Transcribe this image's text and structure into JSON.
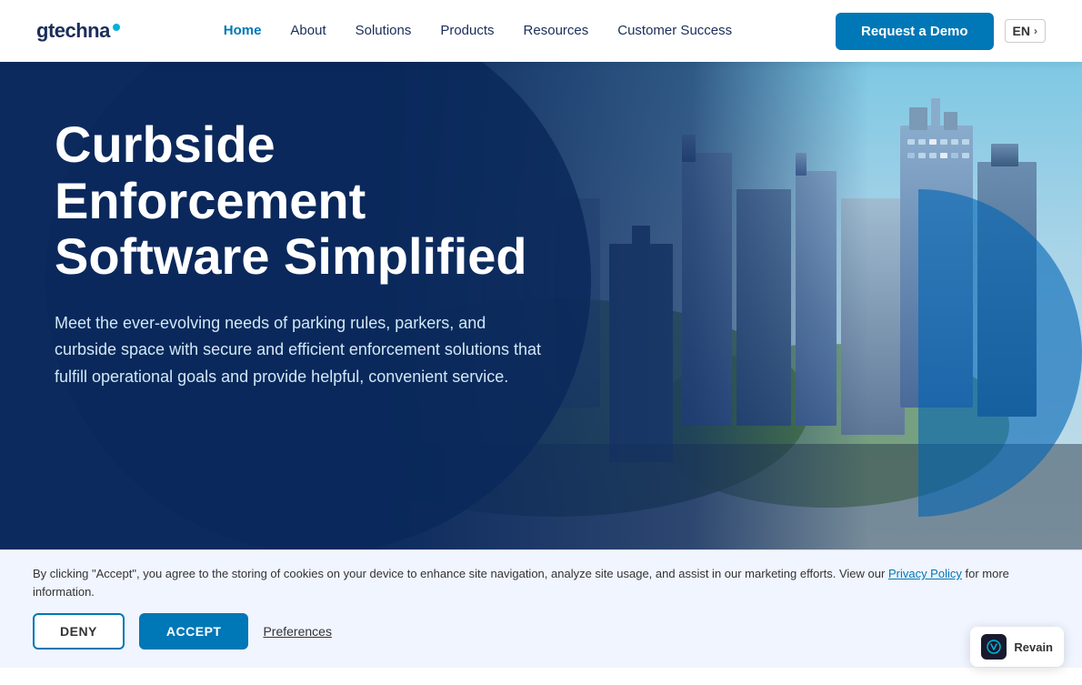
{
  "brand": {
    "logo_text": "gtechna",
    "logo_tm": "™"
  },
  "navbar": {
    "links": [
      {
        "label": "Home",
        "active": true
      },
      {
        "label": "About",
        "active": false
      },
      {
        "label": "Solutions",
        "active": false
      },
      {
        "label": "Products",
        "active": false
      },
      {
        "label": "Resources",
        "active": false
      },
      {
        "label": "Customer Success",
        "active": false
      }
    ],
    "cta_label": "Request a Demo",
    "lang_label": "EN"
  },
  "hero": {
    "title_line1": "Curbside",
    "title_line2": "Enforcement",
    "title_line3": "Software Simplified",
    "subtitle": "Meet the ever-evolving needs of parking rules, parkers, and curbside space with secure and efficient enforcement solutions that fulfill operational goals and provide helpful, convenient service."
  },
  "cookie": {
    "text": "By clicking \"Accept\", you agree to the storing of cookies on your device to enhance site navigation, analyze site usage, and assist in our marketing efforts. View our ",
    "privacy_link": "Privacy Policy",
    "text_after": " for more information.",
    "deny_label": "DENY",
    "accept_label": "ACCEPT",
    "preferences_label": "Preferences"
  },
  "revain": {
    "label": "Revain"
  }
}
